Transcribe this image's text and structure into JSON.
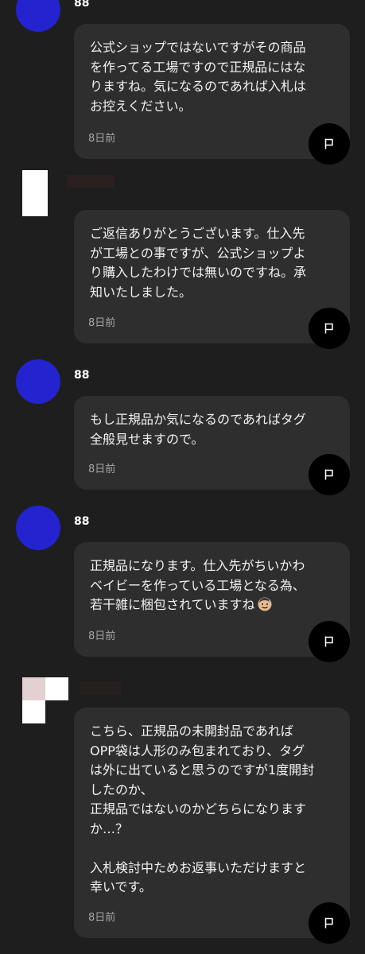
{
  "comments": [
    {
      "user": "88",
      "text": "公式ショップではないですがその商品\nを作ってる工場ですので正規品にはな\nりますね。気になるのであれば入札は\nお控えください。",
      "time": "8日前",
      "flag_icon": "flag-icon"
    },
    {
      "user": "",
      "text": "ご返信ありがとうございます。仕入先\nが工場との事ですが、公式ショップよ\nり購入したわけでは無いのですね。承\n知いたしました。",
      "time": "8日前",
      "flag_icon": "flag-icon"
    },
    {
      "user": "88",
      "text": "もし正規品か気になるのであればタグ\n全般見せますので。",
      "time": "8日前",
      "flag_icon": "flag-icon"
    },
    {
      "user": "88",
      "text": "正規品になります。仕入先がちいかわ\nベイビーを作っている工場となる為、\n若干雑に梱包されていますね",
      "emoji": "sweat-smile-emoji",
      "time": "8日前",
      "flag_icon": "flag-icon"
    },
    {
      "user": "",
      "text": "こちら、正規品の未開封品であれば\nOPP袋は人形のみ包まれており、タグ\nは外に出ていると思うのですが1度開封\nしたのか、\n正規品ではないのかどちらになります\nか…？\n\n入札検討中ためお返事いただけますと\n幸いです。",
      "time": "8日前",
      "flag_icon": "flag-icon"
    }
  ],
  "colors": {
    "background": "#1e1e1e",
    "bubble": "#2e2e2e",
    "avatar": "#2323cf",
    "timestamp": "#a6a6a6",
    "flag_button": "#000000"
  }
}
